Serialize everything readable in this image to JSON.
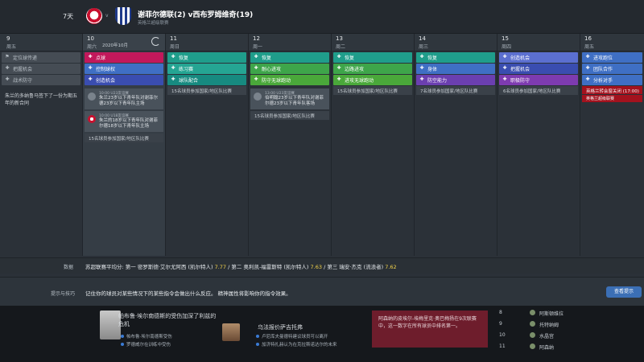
{
  "header": {
    "days_label": "7天",
    "vs": "v",
    "match_title": "谢菲尔德联(2) v西布罗姆维奇(19)",
    "match_sub": "英格兰超级联赛"
  },
  "month_label": "2020年10月",
  "days": [
    {
      "num": "9",
      "name": "周五",
      "note": "朱兰的多纳鲁马签下了一份为期五年的新合同"
    },
    {
      "num": "10",
      "name": "周六"
    },
    {
      "num": "11",
      "name": "周日"
    },
    {
      "num": "12",
      "name": "周一"
    },
    {
      "num": "13",
      "name": "周二"
    },
    {
      "num": "14",
      "name": "周三"
    },
    {
      "num": "15",
      "name": "周四"
    },
    {
      "num": "16",
      "name": "周五"
    }
  ],
  "sessions": {
    "d9": [
      "定位球传递",
      "把握机会",
      "战术防守"
    ],
    "d10": [
      "点球",
      "控制球权",
      "创造机会"
    ],
    "d11": [
      "恢复",
      "练习赛",
      "球队配合"
    ],
    "d12": [
      "恢复",
      "耐心进攻",
      "防守无球跑动"
    ],
    "d13": [
      "恢复",
      "边路进攻",
      "进攻无球跑动"
    ],
    "d14": [
      "恢复",
      "身体",
      "防空能力"
    ],
    "d15": [
      "创造机会",
      "把握机会",
      "职极防守"
    ],
    "d16": [
      "进攻跑位",
      "团队合作",
      "分析对手"
    ]
  },
  "events": {
    "d10_e1_time": "10:00 U23友谊赛",
    "d10_e1_text": "朱兰23岁以下青年队对谢菲尔德23岁以下青年队主场",
    "d10_e2_time": "10:00 U18友谊赛",
    "d10_e2_text": "朱兰的18岁以下青年队对谢菲尔德18岁以下青年队主场",
    "d10_note": "15名球员参加国家/地区队比赛",
    "d11_note": "15名球员参加国家/地区队比赛",
    "d12_e1_time": "13:00 U23友谊赛",
    "d12_e1_text": "伯明翰23岁以下青年队对谢菲尔德23岁以下青年队客场",
    "d12_note": "15名球员参加国家/地区队比赛",
    "d13_note": "15名球员参加国家/地区队比赛",
    "d14_note": "7名球员参加国家/地区队比赛",
    "d15_note": "6名球员参加国家/地区队比赛",
    "d16_note": "英格兰转会窗关闭 (17:00)",
    "d16_sub": "英格兰超级联赛"
  },
  "stats": {
    "label": "数据",
    "prefix": "苏超联赛平均分: 第一 密罗斯德·艾尔尤阿西 (凯尔特人) ",
    "v1": "7.77",
    "mid1": " / 第二 奥利凯-福雷斯特 (凯尔特人) ",
    "v2": "7.63",
    "mid2": " / 第三 瑞安·杰克 (流浪者) ",
    "v3": "7.62"
  },
  "tips": {
    "label": "提示与技巧",
    "text": "记住你的球员对某些情况下的某些指令会做出什么反应。 精神属性将影响你的指令效果。",
    "button": "查看提示"
  },
  "news": {
    "h1": "帕布鲁·埃尔南德斯的受伤加深了利兹的危机",
    "b1a": "帕布鲁·埃尔南德斯受伤",
    "b1b": "罗德威尔在训练中受伤",
    "h2": "乌法报价萨吉托弗",
    "b2a": "卢尼库夫曼德特建议球员可以离开",
    "b2b": "加济特扎赫认为在克拉斯诺达尔的未来",
    "red": "阿森纳的皮埃尔-埃梅里克·奥巴梅扬在9次联赛中，这一数字在所有球员中排名第一。"
  },
  "table": [
    {
      "pos": "8",
      "team": "阿斯顿维拉"
    },
    {
      "pos": "9",
      "team": "托特纳姆"
    },
    {
      "pos": "10",
      "team": "水晶宫"
    },
    {
      "pos": "11",
      "team": "阿森纳"
    }
  ]
}
